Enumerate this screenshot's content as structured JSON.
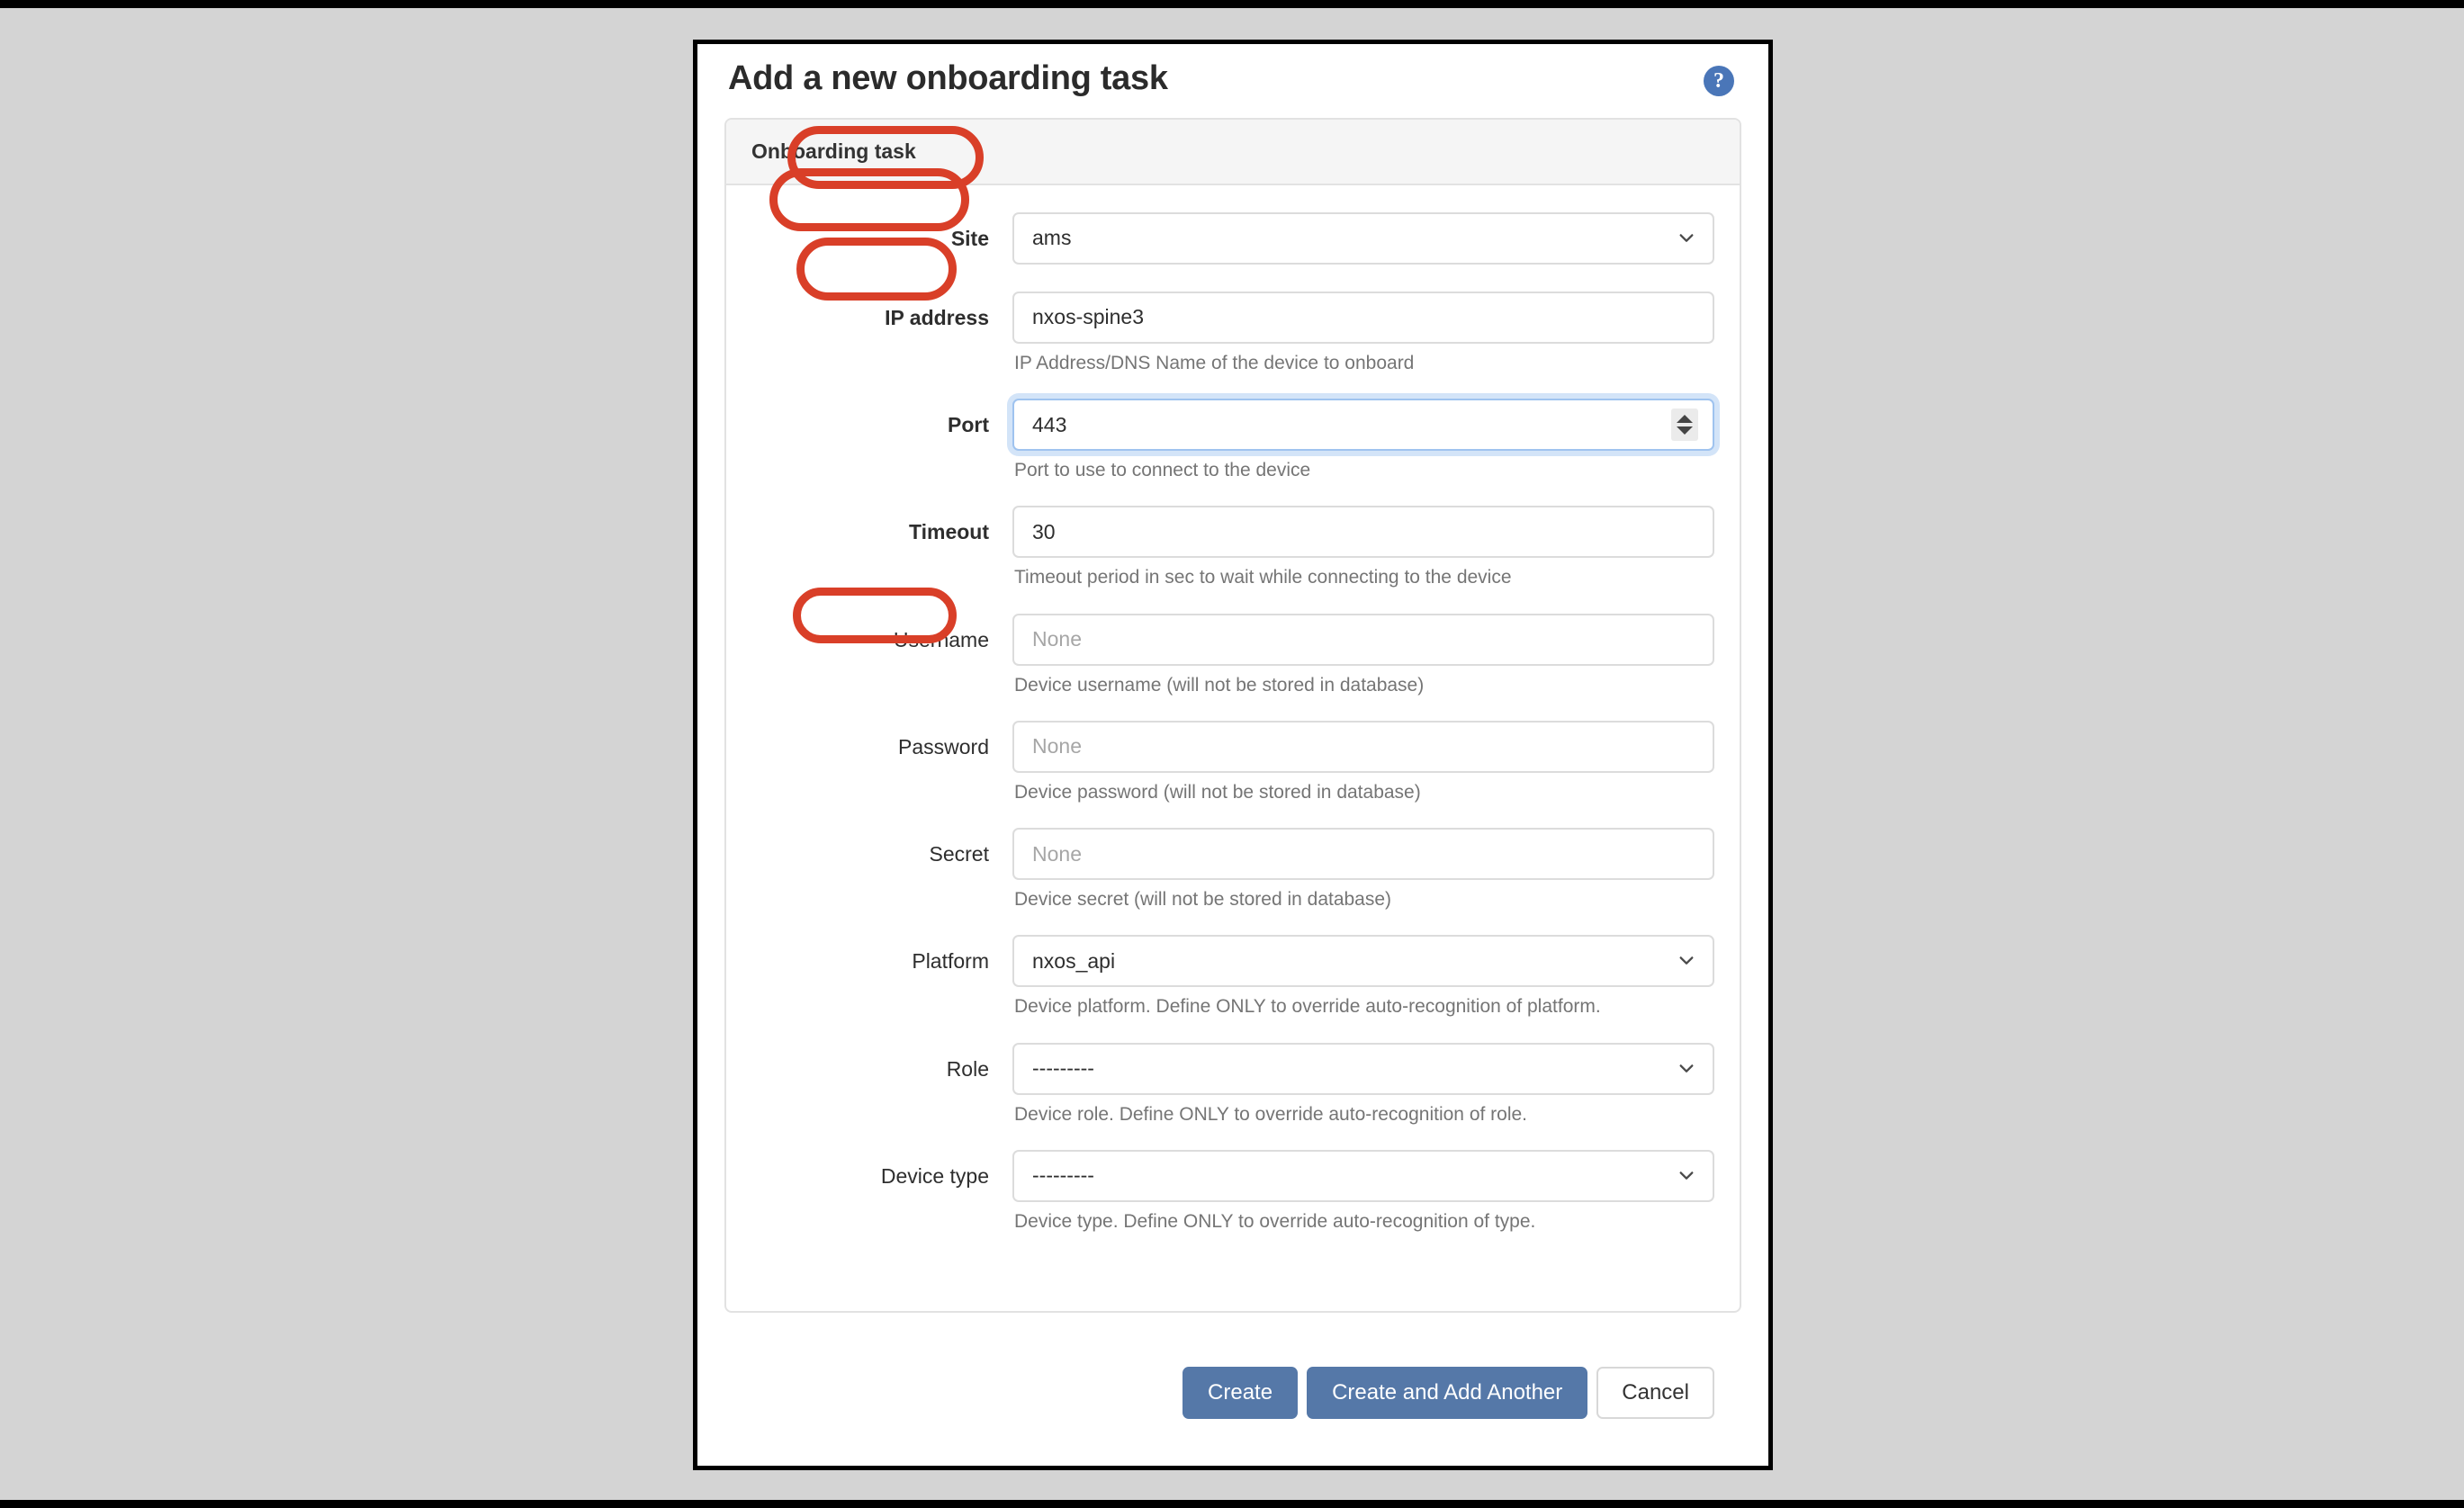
{
  "dialog": {
    "title": "Add a new onboarding task",
    "help_icon": "question-mark-circle-icon",
    "panel_header": "Onboarding task"
  },
  "colors": {
    "annotation_red": "#d93f28",
    "primary_button": "#5578a8",
    "help_icon_blue": "#4a76b8",
    "page_background": "#d4d4d4",
    "panel_header_background": "#f5f5f5"
  },
  "fields": [
    {
      "label": "Site",
      "required": true,
      "control": "select",
      "value": "ams",
      "is_placeholder": false,
      "help": "",
      "focused": false,
      "annotated": true
    },
    {
      "label": "IP address",
      "required": true,
      "control": "text",
      "value": "nxos-spine3",
      "is_placeholder": false,
      "help": "IP Address/DNS Name of the device to onboard",
      "focused": false,
      "annotated": true
    },
    {
      "label": "Port",
      "required": true,
      "control": "number",
      "value": "443",
      "is_placeholder": false,
      "help": "Port to use to connect to the device",
      "focused": true,
      "annotated": true
    },
    {
      "label": "Timeout",
      "required": true,
      "control": "text",
      "value": "30",
      "is_placeholder": false,
      "help": "Timeout period in sec to wait while connecting to the device",
      "focused": false,
      "annotated": false
    },
    {
      "label": "Username",
      "required": false,
      "control": "text",
      "value": "None",
      "is_placeholder": true,
      "help": "Device username (will not be stored in database)",
      "focused": false,
      "annotated": false
    },
    {
      "label": "Password",
      "required": false,
      "control": "text",
      "value": "None",
      "is_placeholder": true,
      "help": "Device password (will not be stored in database)",
      "focused": false,
      "annotated": false
    },
    {
      "label": "Secret",
      "required": false,
      "control": "text",
      "value": "None",
      "is_placeholder": true,
      "help": "Device secret (will not be stored in database)",
      "focused": false,
      "annotated": false
    },
    {
      "label": "Platform",
      "required": false,
      "control": "select",
      "value": "nxos_api",
      "is_placeholder": false,
      "help": "Device platform. Define ONLY to override auto-recognition of platform.",
      "focused": false,
      "annotated": true
    },
    {
      "label": "Role",
      "required": false,
      "control": "select",
      "value": "---------",
      "is_placeholder": false,
      "help": "Device role. Define ONLY to override auto-recognition of role.",
      "focused": false,
      "annotated": false
    },
    {
      "label": "Device type",
      "required": false,
      "control": "select",
      "value": "---------",
      "is_placeholder": false,
      "help": "Device type. Define ONLY to override auto-recognition of type.",
      "focused": false,
      "annotated": false
    }
  ],
  "buttons": [
    {
      "label": "Create",
      "style": "primary"
    },
    {
      "label": "Create and Add Another",
      "style": "primary"
    },
    {
      "label": "Cancel",
      "style": "cancel"
    }
  ]
}
